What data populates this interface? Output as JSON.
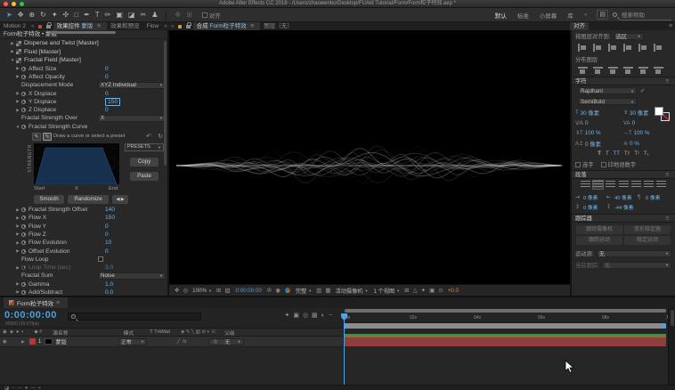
{
  "titlebar": {
    "title": "Adobe After Effects CC 2018 - /Users/zhaowenbo/Desktop/FUAid Tutorial/Form/Form粒子特效.aep *"
  },
  "toolbar": {
    "tools": [
      {
        "name": "selection-tool-icon",
        "glyph": "➤",
        "active": true
      },
      {
        "name": "hand-tool-icon",
        "glyph": "✥"
      },
      {
        "name": "zoom-tool-icon",
        "glyph": "⊕"
      },
      {
        "name": "rotation-tool-icon",
        "glyph": "↻"
      },
      {
        "name": "camera-tool-icon",
        "glyph": "✦"
      },
      {
        "name": "pan-behind-tool-icon",
        "glyph": "✣"
      },
      {
        "name": "shape-tool-icon",
        "glyph": "□"
      },
      {
        "name": "pen-tool-icon",
        "glyph": "✒"
      },
      {
        "name": "type-tool-icon",
        "glyph": "T"
      },
      {
        "name": "brush-tool-icon",
        "glyph": "✏"
      },
      {
        "name": "clone-stamp-tool-icon",
        "glyph": "▣"
      },
      {
        "name": "eraser-tool-icon",
        "glyph": "◪"
      },
      {
        "name": "roto-brush-tool-icon",
        "glyph": "✂"
      },
      {
        "name": "puppet-pin-tool-icon",
        "glyph": "♟"
      }
    ],
    "snap_label": "对齐",
    "workspaces": [
      "默认",
      "标准",
      "小屏幕",
      "库"
    ],
    "overflow_chevron": "»",
    "search_placeholder": "搜索帮助"
  },
  "tabs": {
    "motion2": "Motion 2",
    "effect_controls_label": "效果控件",
    "effect_controls_target": "蒙版",
    "effects_presets": "效果和预设",
    "flow": "Flow",
    "composition_label": "合成",
    "composition_name": "Form粒子特效",
    "layer_tab": "图层（无）",
    "align_tab": "对齐"
  },
  "effect_controls": {
    "header": "Form粒子特效 • 蒙版",
    "groups": [
      {
        "label": "Disperse and Twist [Master]",
        "expanded": false
      },
      {
        "label": "Fluid [Master]",
        "expanded": false
      },
      {
        "label": "Fractal Field [Master]",
        "expanded": true
      }
    ],
    "params_top": [
      {
        "label": "Affect Size",
        "value": "0",
        "kind": "value"
      },
      {
        "label": "Affect Opacity",
        "value": "0",
        "kind": "value"
      },
      {
        "label": "Displacement Mode",
        "value": "XYZ Individual",
        "kind": "dropdown"
      },
      {
        "label": "X Displace",
        "value": "0",
        "kind": "value"
      },
      {
        "label": "Y Displace",
        "value": "150",
        "kind": "value-boxed"
      },
      {
        "label": "Z Displace",
        "value": "0",
        "kind": "value"
      },
      {
        "label": "Fractal Strength Over",
        "value": "X",
        "kind": "dropdown"
      },
      {
        "label": "Fractal Strength Curve",
        "value": "",
        "kind": "group"
      }
    ],
    "curve_editor": {
      "hint": "Draw a curve or select a preset",
      "presets_label": "PRESETS",
      "copy_label": "Copy",
      "paste_label": "Paste",
      "y_axis_label": "STRENGTH",
      "x_labels": [
        "Start",
        "X",
        "End"
      ],
      "smooth_label": "Smooth",
      "randomize_label": "Randomize",
      "curve_fill_color": "#17304d"
    },
    "params_bottom": [
      {
        "label": "Fractal Strength Offset",
        "value": "140",
        "kind": "value"
      },
      {
        "label": "Flow X",
        "value": "150",
        "kind": "value"
      },
      {
        "label": "Flow Y",
        "value": "0",
        "kind": "value"
      },
      {
        "label": "Flow Z",
        "value": "0",
        "kind": "value"
      },
      {
        "label": "Flow Evolution",
        "value": "10",
        "kind": "value"
      },
      {
        "label": "Offset Evolution",
        "value": "0",
        "kind": "value"
      },
      {
        "label": "Flow Loop",
        "value": "",
        "kind": "checkbox"
      },
      {
        "label": "Loop Time (sec)",
        "value": "3.0",
        "kind": "value",
        "disabled": true
      },
      {
        "label": "Fractal Sum",
        "value": "Noise",
        "kind": "dropdown"
      },
      {
        "label": "Gamma",
        "value": "1.0",
        "kind": "value"
      },
      {
        "label": "Add/Subtract",
        "value": "0.0",
        "kind": "value"
      }
    ]
  },
  "viewer": {
    "zoom": "100%",
    "timecode": "0:00:00:00",
    "resolution": "完整",
    "camera_view": "活动摄像机",
    "view_count": "1 个视图",
    "exposure": "+0.0"
  },
  "align_panel": {
    "title": "对齐",
    "align_to_label": "将图层对齐到:",
    "align_to_value": "选区",
    "distribute_label": "分布图层"
  },
  "character_panel": {
    "title": "字符",
    "font_name": "Rajdhani",
    "font_style": "SemiBold",
    "font_size": "30 像素",
    "leading": "30 像素",
    "kerning": "0",
    "tracking": "0",
    "vertical_scale": "100 %",
    "horizontal_scale": "100 %",
    "baseline_shift": "0 像素",
    "proportional_spacing": "0 %",
    "ligatures_label": "连字",
    "hindi_digits_label": "印地语数字"
  },
  "paragraph_panel": {
    "title": "段落",
    "fields": [
      "0 像素",
      "40 像素",
      "0 像素",
      "0 像素",
      "-44 像素"
    ]
  },
  "tracker_panel": {
    "title": "跟踪器",
    "buttons": [
      "跟踪摄像机",
      "变形稳定器",
      "跟踪运动",
      "稳定运动"
    ],
    "motion_source_label": "运动源:",
    "motion_source_value": "无",
    "current_track_label": "当前跟踪:",
    "current_track_value": "无"
  },
  "timeline": {
    "tab": "Form粒子特效",
    "timecode": "0:00:00:00",
    "timecode_sub": "00000 (29.97fps)",
    "columns": {
      "source_name": "源名称",
      "mode": "模式",
      "trkmat": "T TrkMat",
      "parent": "父级"
    },
    "layer": {
      "index": "1",
      "name": "蒙版",
      "mode": "正常",
      "parent": "无"
    },
    "ruler_labels": [
      "0s",
      "02s",
      "04s",
      "06s",
      "08s",
      "10s"
    ]
  }
}
